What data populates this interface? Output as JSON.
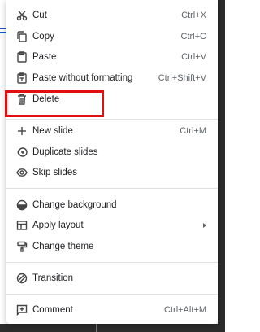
{
  "menu": {
    "items": [
      {
        "key": "cut",
        "label": "Cut",
        "shortcut": "Ctrl+X",
        "icon": "scissors-icon"
      },
      {
        "key": "copy",
        "label": "Copy",
        "shortcut": "Ctrl+C",
        "icon": "copy-icon"
      },
      {
        "key": "paste",
        "label": "Paste",
        "shortcut": "Ctrl+V",
        "icon": "clipboard-icon"
      },
      {
        "key": "paste_plain",
        "label": "Paste without formatting",
        "shortcut": "Ctrl+Shift+V",
        "icon": "clipboard-text-icon"
      },
      {
        "key": "delete",
        "label": "Delete",
        "shortcut": "",
        "icon": "trash-icon"
      },
      {
        "key": "new_slide",
        "label": "New slide",
        "shortcut": "Ctrl+M",
        "icon": "plus-icon"
      },
      {
        "key": "duplicate",
        "label": "Duplicate slides",
        "shortcut": "",
        "icon": "duplicate-icon"
      },
      {
        "key": "skip",
        "label": "Skip slides",
        "shortcut": "",
        "icon": "eye-icon"
      },
      {
        "key": "change_bg",
        "label": "Change background",
        "shortcut": "",
        "icon": "background-icon"
      },
      {
        "key": "apply_layout",
        "label": "Apply layout",
        "shortcut": "",
        "icon": "layout-icon"
      },
      {
        "key": "change_theme",
        "label": "Change theme",
        "shortcut": "",
        "icon": "paint-roller-icon"
      },
      {
        "key": "transition",
        "label": "Transition",
        "shortcut": "",
        "icon": "transition-icon"
      },
      {
        "key": "comment",
        "label": "Comment",
        "shortcut": "Ctrl+Alt+M",
        "icon": "add-comment-icon"
      }
    ]
  },
  "colors": {
    "highlight": "#e01010",
    "text": "#202124",
    "shortcut": "#5f6368"
  }
}
